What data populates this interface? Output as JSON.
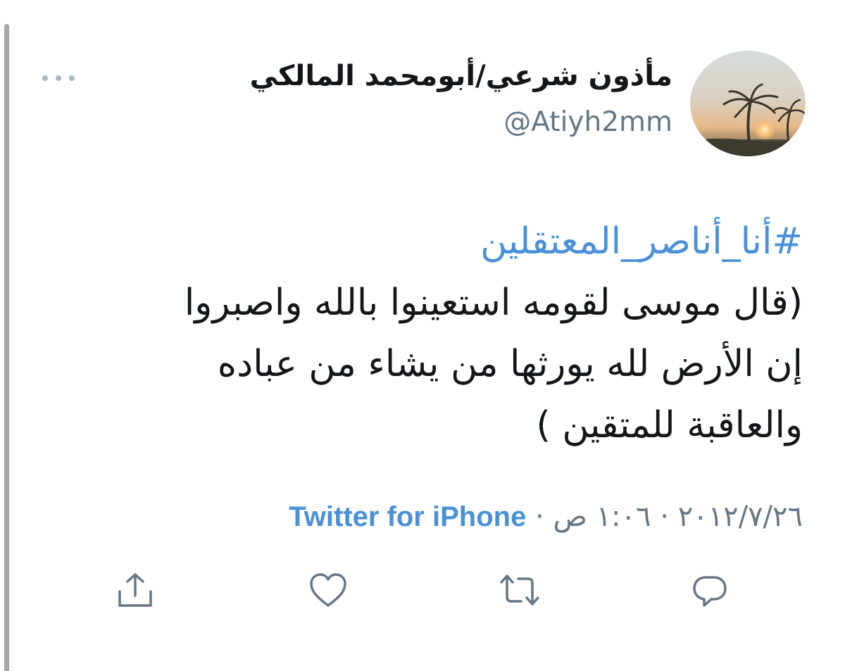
{
  "user": {
    "display_name": "مأذون شرعي/أبومحمد المالكي",
    "handle": "@Atiyh2mm",
    "avatar_icon": "palm-trees-sunset-photo"
  },
  "tweet": {
    "hashtag": "#أنا_أناصر_المعتقلين",
    "lines": [
      "(قال موسى لقومه استعينوا بالله واصبروا",
      "إن الأرض لله يورثها من يشاء من عباده",
      "والعاقبة للمتقين )"
    ]
  },
  "meta": {
    "date": "٢٠١٢/٧/٢٦",
    "separator": "·",
    "time": "١:٠٦ ص",
    "source": "Twitter for iPhone"
  },
  "actions": {
    "reply_icon": "reply-icon",
    "retweet_icon": "retweet-icon",
    "like_icon": "heart-icon",
    "share_icon": "share-icon"
  },
  "colors": {
    "link": "#4a90d9",
    "secondary_text": "#657786",
    "icon": "#657786"
  }
}
